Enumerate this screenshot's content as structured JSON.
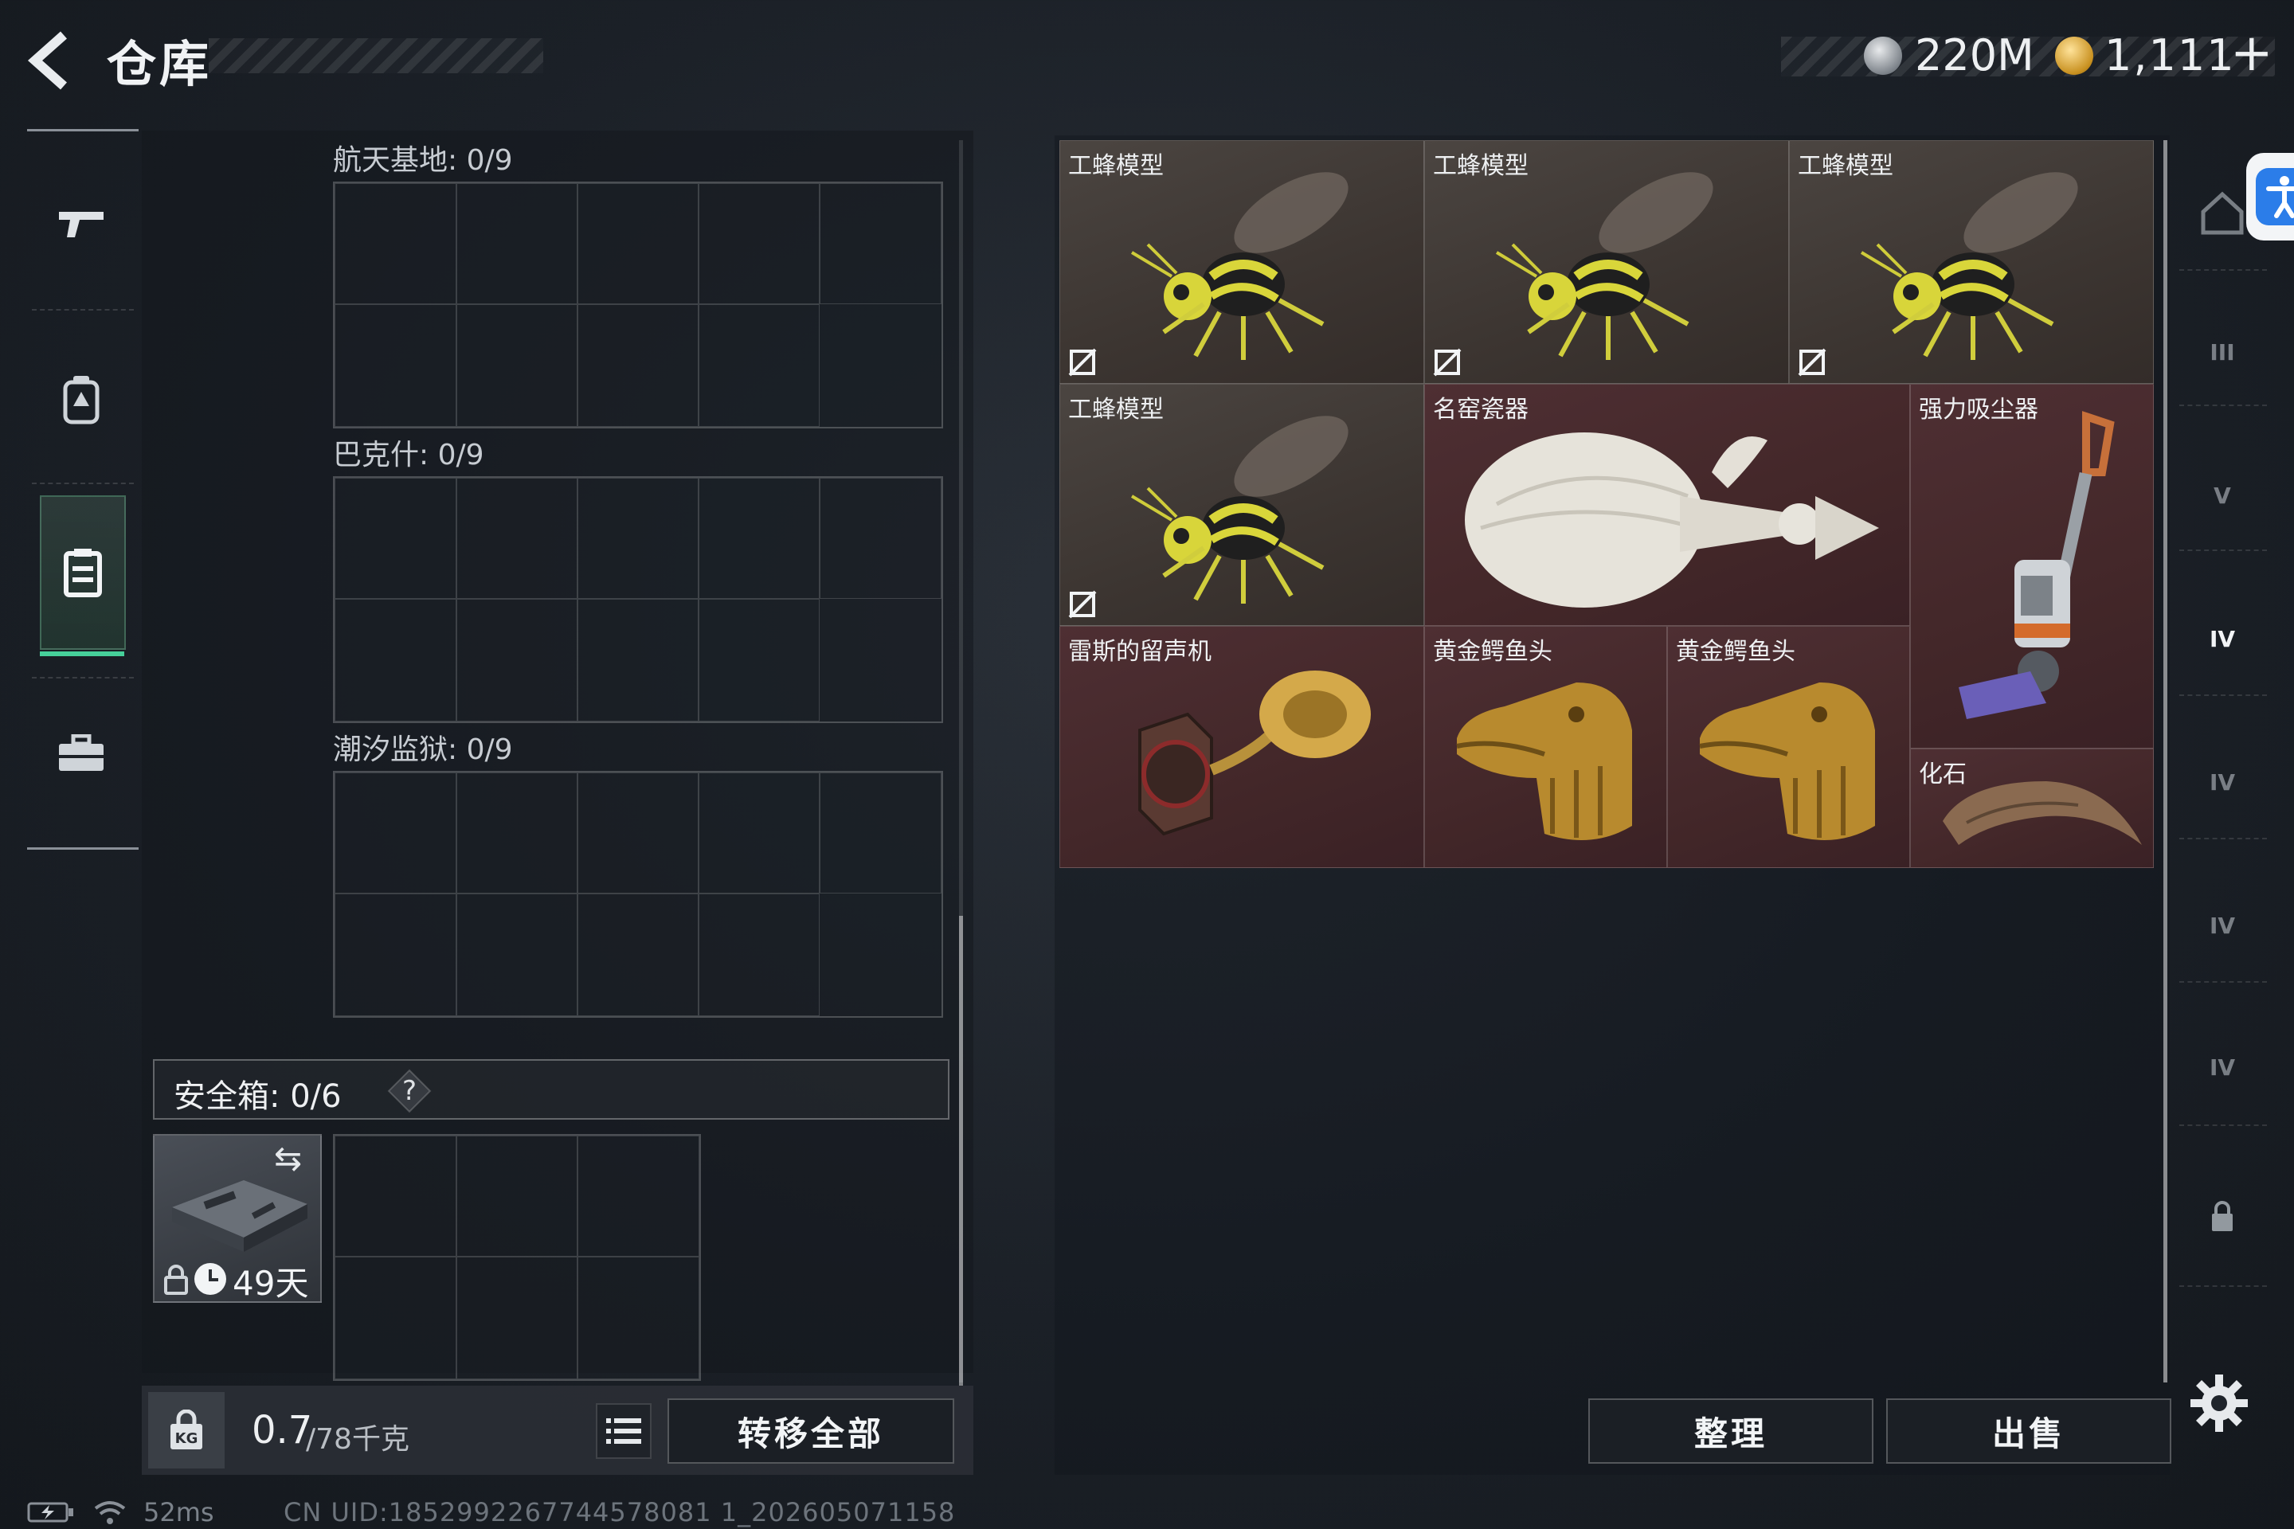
{
  "header": {
    "title": "仓库",
    "currencies": [
      {
        "icon": "silver-coin-icon",
        "value": "220M"
      },
      {
        "icon": "gold-triangle-coin-icon",
        "value": "1,111"
      }
    ],
    "plus_label": "+"
  },
  "left_rail": {
    "items": [
      {
        "icon": "gun-icon"
      },
      {
        "icon": "backpack-icon"
      },
      {
        "icon": "storage-box-icon",
        "active": true
      },
      {
        "icon": "toolbox-icon"
      }
    ]
  },
  "containers": {
    "sections": [
      {
        "label": "航天基地: 0/9"
      },
      {
        "label": "巴克什: 0/9"
      },
      {
        "label": "潮汐监狱: 0/9"
      }
    ],
    "safe_box": {
      "label": "安全箱:  0/6",
      "help": "?",
      "item_days": "49天",
      "swap_icon": "⇆"
    }
  },
  "bottom_left": {
    "weight_main": "0.7",
    "weight_total": "/78千克",
    "transfer_all": "转移全部"
  },
  "items": [
    {
      "name": "工蜂模型",
      "rarity": "common",
      "art": "bee",
      "no_trade": true
    },
    {
      "name": "工蜂模型",
      "rarity": "common",
      "art": "bee",
      "no_trade": true
    },
    {
      "name": "工蜂模型",
      "rarity": "common",
      "art": "bee",
      "no_trade": true
    },
    {
      "name": "工蜂模型",
      "rarity": "common",
      "art": "bee",
      "no_trade": true
    },
    {
      "name": "名窑瓷器",
      "rarity": "rare",
      "art": "vase"
    },
    {
      "name": "强力吸尘器",
      "rarity": "rare",
      "art": "vacuum"
    },
    {
      "name": "雷斯的留声机",
      "rarity": "rare",
      "art": "phonograph"
    },
    {
      "name": "黄金鳄鱼头",
      "rarity": "rare",
      "art": "croc-head"
    },
    {
      "name": "黄金鳄鱼头",
      "rarity": "rare",
      "art": "croc-head"
    },
    {
      "name": "化石",
      "rarity": "rare",
      "art": "fossil"
    }
  ],
  "actions": {
    "sort": "整理",
    "sell": "出售"
  },
  "right_rail": {
    "items": [
      {
        "icon": "house-icon",
        "label": ""
      },
      {
        "icon": "tier-iii-icon",
        "label": "III"
      },
      {
        "icon": "tier-v-icon",
        "label": "V"
      },
      {
        "icon": "tier-iv-active-icon",
        "label": "IV"
      },
      {
        "icon": "tier-iv-icon",
        "label": "IV"
      },
      {
        "icon": "tier-iv-icon",
        "label": "IV"
      },
      {
        "icon": "tier-iv-icon",
        "label": "IV"
      },
      {
        "icon": "lock-icon",
        "label": ""
      }
    ]
  },
  "status": {
    "ping": "52ms",
    "uid": "CN UID:1852992267744578081 1_202605071158"
  },
  "colors": {
    "accent_green": "#46d09a",
    "rare_bg": "#432729",
    "common_bg": "#3c3531",
    "accessibility_blue": "#2b7de9"
  }
}
